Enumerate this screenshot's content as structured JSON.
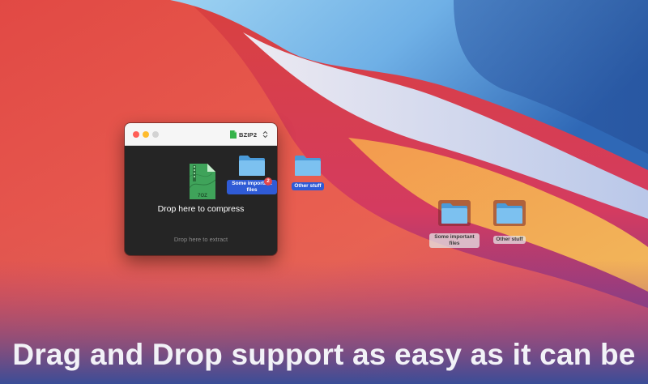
{
  "app": {
    "format_selector": {
      "value": "BZIP2",
      "icon": "zip-file-icon"
    },
    "archive_icon_label": "7OZ",
    "drop_compress_text": "Drop here to compress",
    "drop_extract_text": "Drop here to extract"
  },
  "dragged_items": {
    "badge_count": "2",
    "folders": [
      {
        "label": "Some important files",
        "icon": "folder-icon"
      },
      {
        "label": "Other stuff",
        "icon": "folder-icon"
      }
    ]
  },
  "desktop_items": [
    {
      "label": "Some important files",
      "icon": "folder-icon"
    },
    {
      "label": "Other stuff",
      "icon": "folder-icon"
    }
  ],
  "caption": "Drag and Drop support as easy as it can be",
  "colors": {
    "selection_blue": "#2f5bd6",
    "badge_red": "#e5474b",
    "folder_blue": "#6fb7ec"
  }
}
